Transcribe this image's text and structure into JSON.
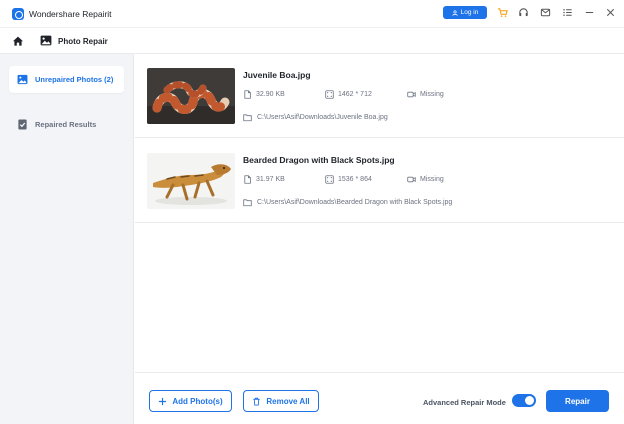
{
  "window": {
    "title": "Wondershare Repairit"
  },
  "titlebar": {
    "login_label": "Log in",
    "icons": [
      "user-icon",
      "cart-icon",
      "headset-icon",
      "mail-icon",
      "menu-icon",
      "minimize-icon",
      "close-icon"
    ]
  },
  "nav": {
    "title": "Photo Repair"
  },
  "sidebar": {
    "items": [
      {
        "label": "Unrepaired Photos (2)",
        "icon": "image-icon",
        "active": true
      },
      {
        "label": "Repaired Results",
        "icon": "document-check-icon",
        "active": false
      }
    ]
  },
  "files": [
    {
      "name": "Juvenile Boa.jpg",
      "size": "32.90  KB",
      "resolution": "1462 * 712",
      "camera": "Missing",
      "path": "C:\\Users\\Asif\\Downloads\\Juvenile Boa.jpg"
    },
    {
      "name": "Bearded Dragon with Black Spots.jpg",
      "size": "31.97  KB",
      "resolution": "1536 * 864",
      "camera": "Missing",
      "path": "C:\\Users\\Asif\\Downloads\\Bearded Dragon with Black Spots.jpg"
    }
  ],
  "footer": {
    "add_label": "Add Photo(s)",
    "remove_label": "Remove All",
    "advanced_label": "Advanced Repair Mode",
    "advanced_on": true,
    "repair_label": "Repair"
  },
  "colors": {
    "accent": "#1e73e8",
    "cart": "#f5a623",
    "sidebar_bg": "#f2f4f7"
  }
}
